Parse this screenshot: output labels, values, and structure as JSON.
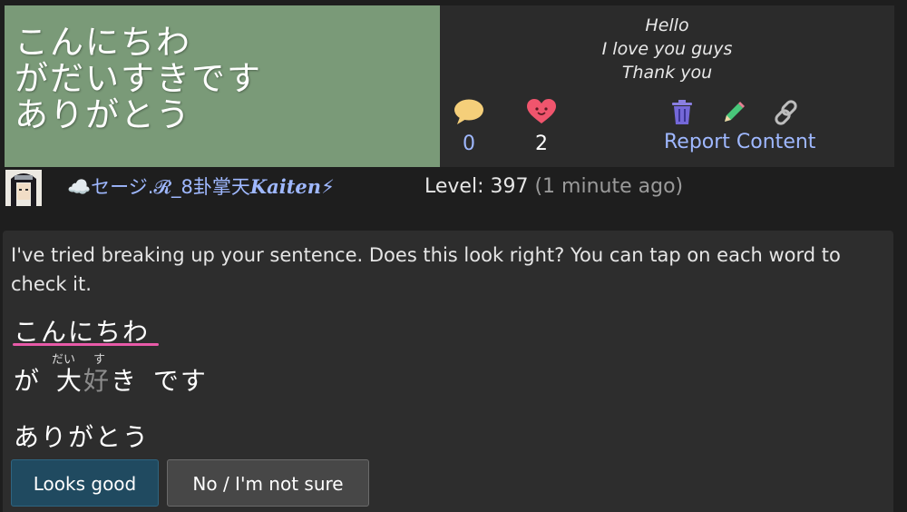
{
  "post": {
    "image_lines": [
      "こんにちわ",
      "がだいすきです",
      "ありがとう"
    ],
    "text_lines": [
      "Hello",
      "I love you guys",
      "Thank you"
    ],
    "comments_count": "0",
    "likes_count": "2",
    "report_label": "Report Content",
    "colors": {
      "image_bg": "#7a9a78",
      "accent_link": "#9fb8ff",
      "heart": "#f0556d",
      "comment_bubble": "#f5cf7a"
    }
  },
  "author": {
    "username": "☁️セージ.𝓡_8卦掌天",
    "username_suffix": "Kaiten",
    "username_emoji": "⚡",
    "level_label": "Level: 397",
    "time_ago": "(1 minute ago)"
  },
  "comment": {
    "text": "I've tried breaking up your sentence. Does this look right? You can tap on each word to check it.",
    "row1": "こんにちわ",
    "row2_parts": [
      "が",
      "大",
      "好",
      "き",
      "です"
    ],
    "ruby_dai": "だい",
    "ruby_su": "す",
    "row3": "ありがとう",
    "looks_good_label": "Looks good",
    "not_sure_label": "No / I'm not sure"
  }
}
